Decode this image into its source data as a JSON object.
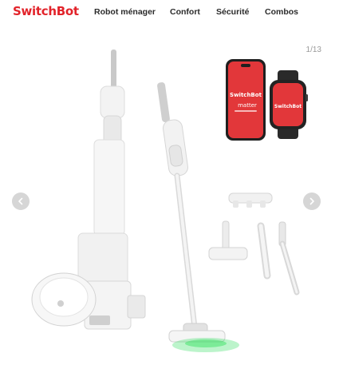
{
  "brand": {
    "logo_text": "SwitchBot",
    "accent_color": "#e2232a"
  },
  "nav": {
    "items": [
      {
        "label": "Robot ménager"
      },
      {
        "label": "Confort"
      },
      {
        "label": "Sécurité"
      },
      {
        "label": "Combos"
      }
    ]
  },
  "gallery": {
    "counter": "1/13",
    "prev_icon": "chevron-left-icon",
    "next_icon": "chevron-right-icon",
    "phone_brand": "SwitchBot",
    "phone_partner": "matter",
    "watch_brand": "SwitchBot"
  }
}
